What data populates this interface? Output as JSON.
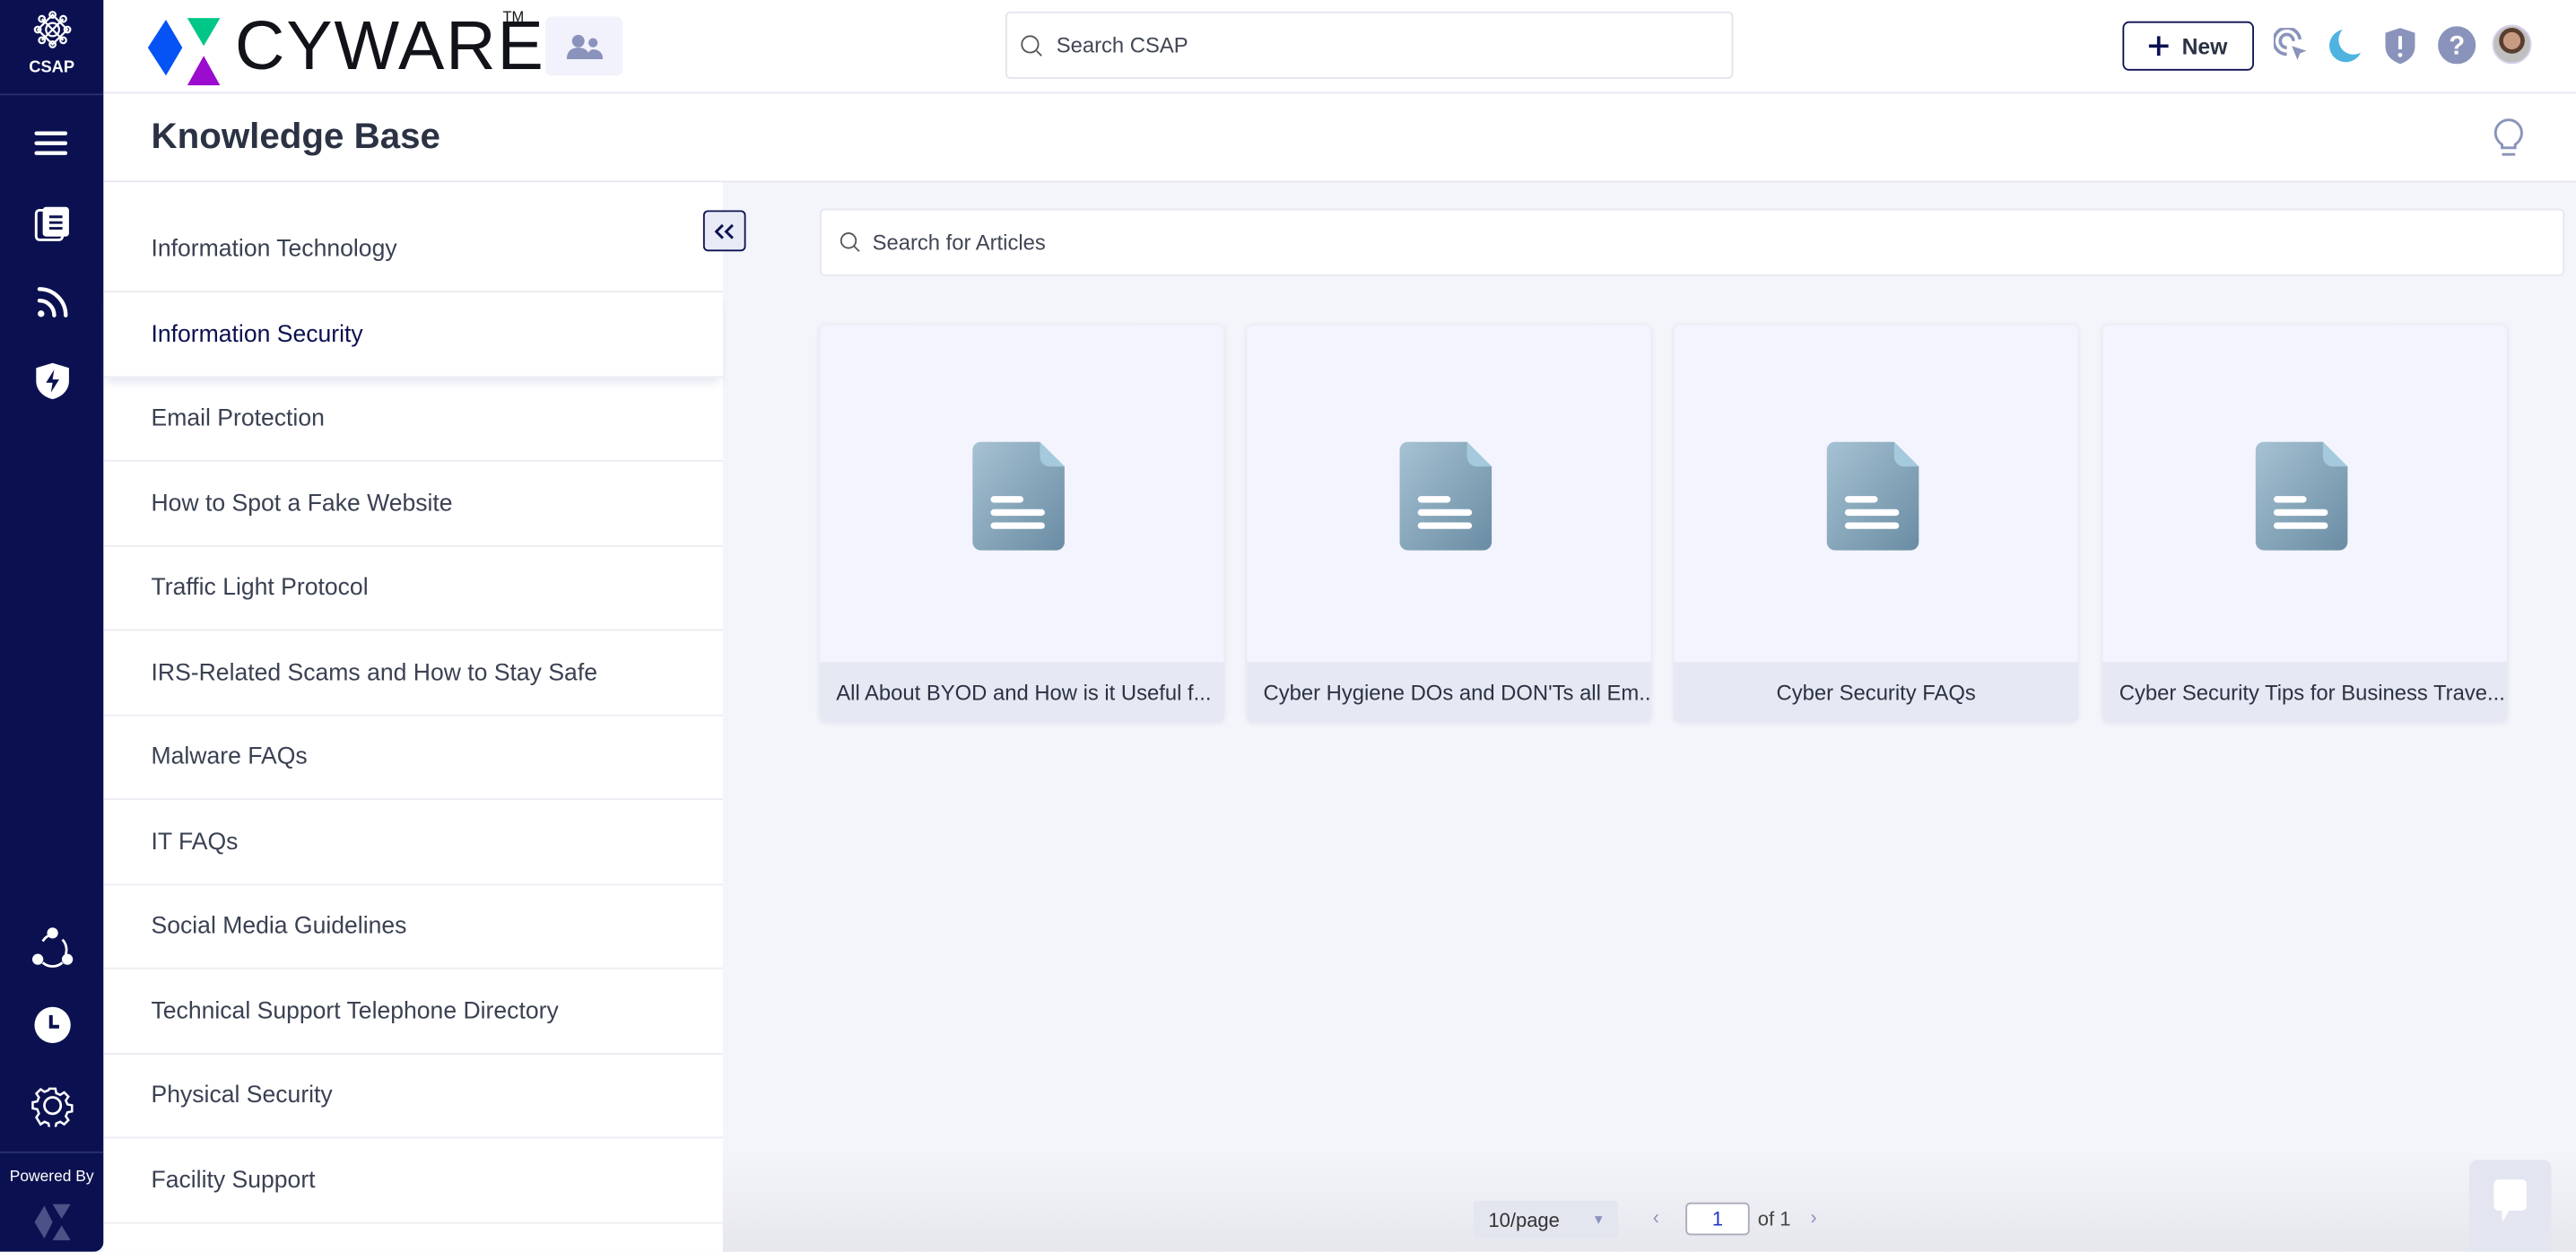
{
  "app": {
    "name": "CSAP",
    "brand": "CYWARE",
    "trademark": "TM",
    "powered_by": "Powered By"
  },
  "header": {
    "search_placeholder": "Search CSAP",
    "new_label": "New"
  },
  "page": {
    "title": "Knowledge Base"
  },
  "categories": [
    {
      "label": "Information Technology"
    },
    {
      "label": "Information Security",
      "active": true
    },
    {
      "label": "Email Protection"
    },
    {
      "label": "How to Spot a Fake Website"
    },
    {
      "label": "Traffic Light Protocol"
    },
    {
      "label": "IRS-Related Scams and How to Stay Safe"
    },
    {
      "label": "Malware FAQs"
    },
    {
      "label": "IT FAQs"
    },
    {
      "label": "Social Media Guidelines"
    },
    {
      "label": "Technical Support Telephone Directory"
    },
    {
      "label": "Physical Security"
    },
    {
      "label": "Facility Support"
    }
  ],
  "articles_search": {
    "placeholder": "Search for Articles"
  },
  "articles": [
    {
      "title": "All About BYOD and How is it Useful f..."
    },
    {
      "title": "Cyber Hygiene DOs and DON'Ts all Em..."
    },
    {
      "title": "Cyber Security FAQs"
    },
    {
      "title": "Cyber Security Tips for Business Trave..."
    }
  ],
  "pagination": {
    "page_size": "10/page",
    "current_page": "1",
    "of_label": "of 1"
  },
  "colors": {
    "nav": "#0b1150",
    "accent": "#8a93bb",
    "moon": "#4fb3e0"
  }
}
